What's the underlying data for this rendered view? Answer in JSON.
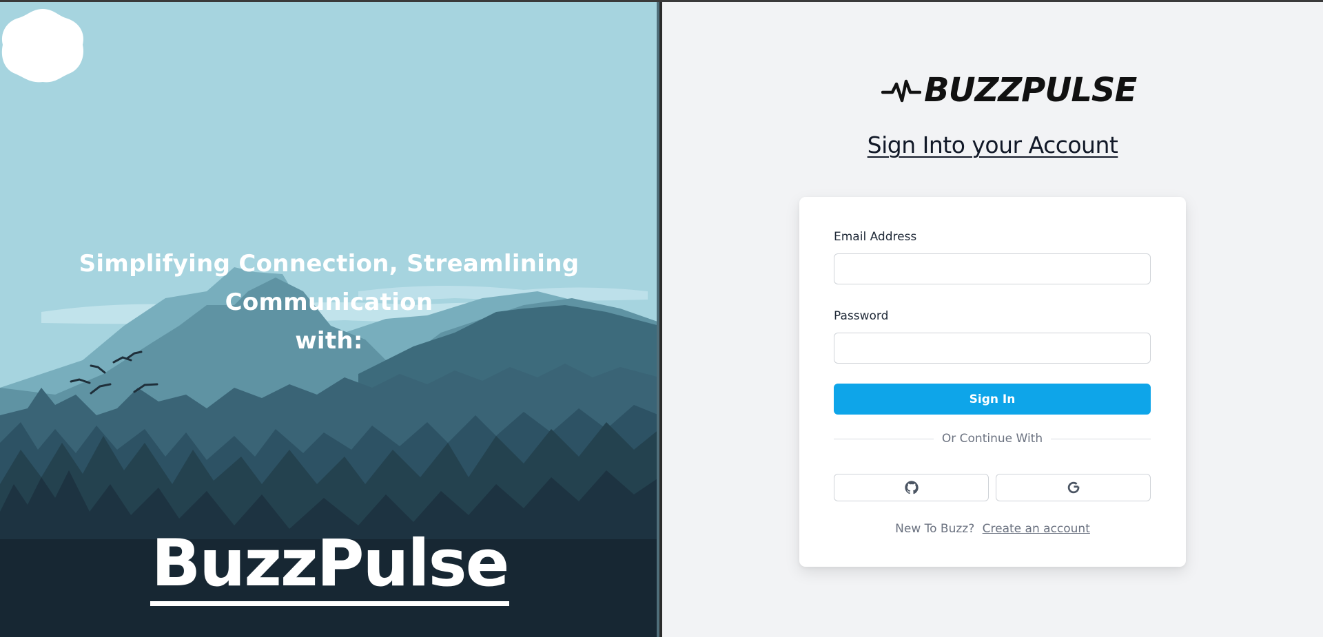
{
  "hero": {
    "tagline_line1": "Simplifying Connection, Streamlining Communication",
    "tagline_line2": "with:",
    "brand_name": "BuzzPulse"
  },
  "logo": {
    "text": "BUZZPULSE",
    "icon": "pulse-icon"
  },
  "login": {
    "heading": "Sign Into your Account",
    "email_label": "Email Address",
    "email_value": "",
    "password_label": "Password",
    "password_value": "",
    "sign_in_label": "Sign In",
    "divider_text": "Or Continue With",
    "social": [
      {
        "name": "github-icon"
      },
      {
        "name": "google-icon"
      }
    ],
    "footer_prompt": "New To Buzz?",
    "create_account_label": "Create an account"
  },
  "colors": {
    "primary": "#0ea5e9",
    "panel_bg": "#f2f3f5",
    "sky": "#a6d4df",
    "forest_dark": "#1a2a36"
  }
}
